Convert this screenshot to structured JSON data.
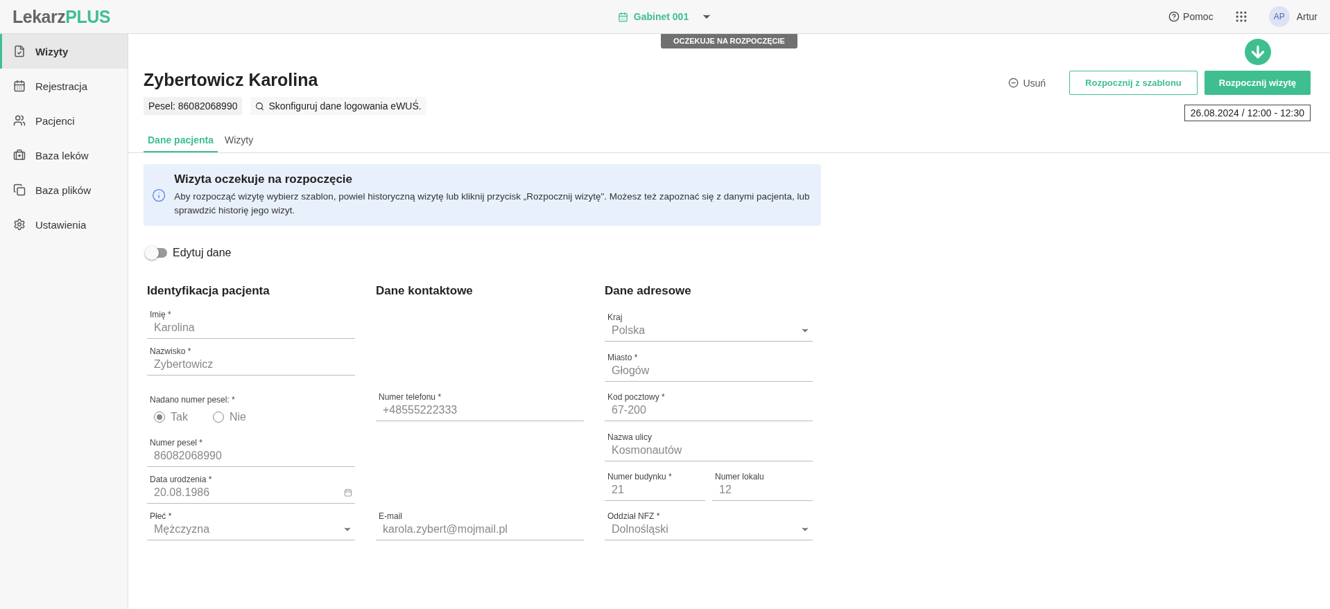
{
  "header": {
    "logo_main": "Lekarz",
    "logo_accent": "PLUS",
    "office": "Gabinet 001",
    "help": "Pomoc",
    "user_initials": "AP",
    "user_name": "Artur"
  },
  "sidebar": {
    "items": [
      {
        "label": "Wizyty",
        "selected": true
      },
      {
        "label": "Rejestracja",
        "selected": false
      },
      {
        "label": "Pacjenci",
        "selected": false
      },
      {
        "label": "Baza leków",
        "selected": false
      },
      {
        "label": "Baza plików",
        "selected": false
      },
      {
        "label": "Ustawienia",
        "selected": false
      }
    ]
  },
  "status_badge": "OCZEKUJE NA ROZPOCZĘCIE",
  "patient": {
    "name": "Zybertowicz Karolina",
    "pesel": "Pesel: 86082068990",
    "ewus_link": "Skonfiguruj dane logowania eWUŚ."
  },
  "actions": {
    "delete": "Usuń",
    "template": "Rozpocznij z szablonu",
    "start": "Rozpocznij wizytę",
    "datetime": "26.08.2024 / 12:00 - 12:30"
  },
  "tabs": [
    {
      "label": "Dane pacjenta",
      "selected": true
    },
    {
      "label": "Wizyty",
      "selected": false
    }
  ],
  "info": {
    "title": "Wizyta oczekuje na rozpoczęcie",
    "text": "Aby rozpocząć wizytę wybierz szablon, powiel historyczną wizytę lub kliknij przycisk „Rozpocznij wizytę\". Możesz też zapoznać się z danymi pacjenta, lub sprawdzić historię jego wizyt."
  },
  "edit_toggle": {
    "label": "Edytuj dane",
    "on": false
  },
  "sections": [
    {
      "title": "Identyfikacja pacjenta",
      "fields": [
        {
          "kind": "text",
          "label": "Imię *",
          "value": "Karolina"
        },
        {
          "kind": "text",
          "label": "Nazwisko *",
          "value": "Zybertowicz"
        },
        {
          "kind": "radio",
          "label": "Nadano numer pesel: *",
          "options": [
            {
              "label": "Tak",
              "selected": true
            },
            {
              "label": "Nie",
              "selected": false
            }
          ]
        },
        {
          "kind": "text",
          "label": "Numer pesel *",
          "value": "86082068990"
        },
        {
          "kind": "date",
          "label": "Data urodzenia *",
          "value": "20.08.1986"
        },
        {
          "kind": "select",
          "label": "Płeć *",
          "value": "Mężczyzna"
        }
      ]
    },
    {
      "title": "Dane kontaktowe",
      "fields": [
        {
          "kind": "text",
          "label": "Numer telefonu *",
          "value": "+48555222333"
        },
        {
          "kind": "text",
          "label": "E-mail",
          "value": "karola.zybert@mojmail.pl"
        }
      ]
    },
    {
      "title": "Dane adresowe",
      "fields": [
        {
          "kind": "select",
          "label": "Kraj",
          "value": "Polska"
        },
        {
          "kind": "text",
          "label": "Miasto *",
          "value": "Głogów"
        },
        {
          "kind": "text",
          "label": "Kod pocztowy *",
          "value": "67-200"
        },
        {
          "kind": "text",
          "label": "Nazwa ulicy",
          "value": "Kosmonautów"
        },
        {
          "kind": "row",
          "fields": [
            {
              "kind": "text",
              "label": "Numer budynku *",
              "value": "21"
            },
            {
              "kind": "text",
              "label": "Numer lokalu",
              "value": "12"
            }
          ]
        },
        {
          "kind": "select",
          "label": "Oddział NFZ *",
          "value": "Dolnośląski"
        }
      ]
    }
  ]
}
